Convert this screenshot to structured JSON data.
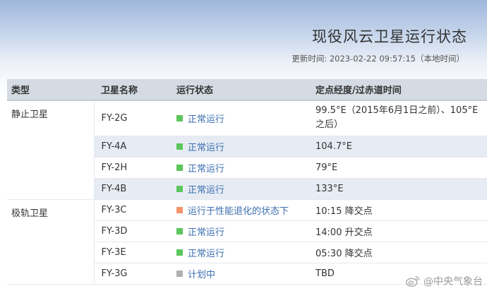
{
  "header": {
    "title": "现役风云卫星运行状态",
    "updated": "更新时间: 2023-02-22 09:57:15（本地时间）"
  },
  "table": {
    "columns": [
      "类型",
      "卫星名称",
      "运行状态",
      "定点经度/过赤道时间"
    ],
    "groups": [
      {
        "type": "静止卫星",
        "rows": [
          {
            "name": "FY-2G",
            "status": "正常运行",
            "status_color": "#5cc65c",
            "position": "99.5°E（2015年6月1日之前）、105°E之后）"
          },
          {
            "name": "FY-4A",
            "status": "正常运行",
            "status_color": "#5cc65c",
            "position": "104.7°E"
          },
          {
            "name": "FY-2H",
            "status": "正常运行",
            "status_color": "#5cc65c",
            "position": "79°E"
          },
          {
            "name": "FY-4B",
            "status": "正常运行",
            "status_color": "#5cc65c",
            "position": "133°E"
          }
        ]
      },
      {
        "type": "极轨卫星",
        "rows": [
          {
            "name": "FY-3C",
            "status": "运行于性能退化的状态下",
            "status_color": "#f5956b",
            "position": "10:15 降交点"
          },
          {
            "name": "FY-3D",
            "status": "正常运行",
            "status_color": "#5cc65c",
            "position": "14:00 升交点"
          },
          {
            "name": "FY-3E",
            "status": "正常运行",
            "status_color": "#5cc65c",
            "position": "05:30 降交点"
          },
          {
            "name": "FY-3G",
            "status": "计划中",
            "status_color": "#b0b0b0",
            "position": "TBD"
          }
        ]
      }
    ]
  },
  "watermark": {
    "text": "@中央气象台",
    "icon": "weibo-icon"
  }
}
